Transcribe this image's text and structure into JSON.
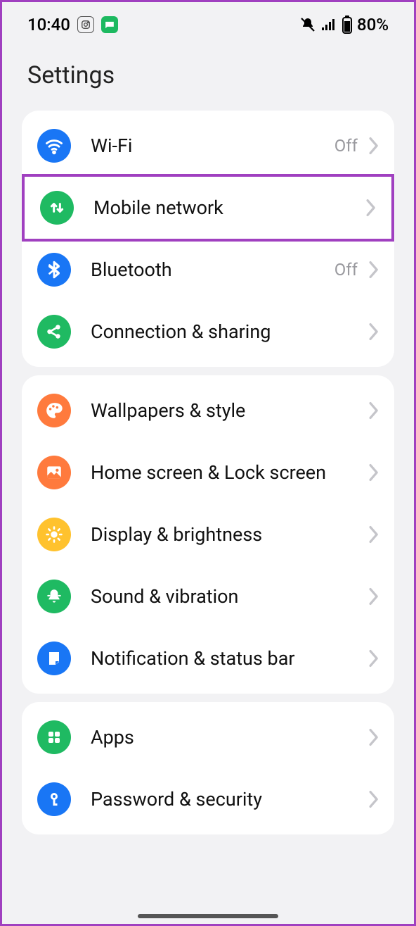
{
  "statusbar": {
    "time": "10:40",
    "battery": "80%"
  },
  "header": {
    "title": "Settings"
  },
  "groups": [
    {
      "rows": [
        {
          "id": "wifi",
          "label": "Wi-Fi",
          "status": "Off",
          "icon": "wifi-icon",
          "color": "c-blue",
          "highlight": false
        },
        {
          "id": "mobile-network",
          "label": "Mobile network",
          "status": "",
          "icon": "mobile-data-icon",
          "color": "c-green",
          "highlight": true
        },
        {
          "id": "bluetooth",
          "label": "Bluetooth",
          "status": "Off",
          "icon": "bluetooth-icon",
          "color": "c-blue",
          "highlight": false
        },
        {
          "id": "connection-sharing",
          "label": "Connection & sharing",
          "status": "",
          "icon": "share-icon",
          "color": "c-green",
          "highlight": false
        }
      ]
    },
    {
      "rows": [
        {
          "id": "wallpapers",
          "label": "Wallpapers & style",
          "status": "",
          "icon": "palette-icon",
          "color": "c-orange",
          "highlight": false
        },
        {
          "id": "home-lock",
          "label": "Home screen & Lock screen",
          "status": "",
          "icon": "picture-icon",
          "color": "c-orange",
          "highlight": false
        },
        {
          "id": "display",
          "label": "Display & brightness",
          "status": "",
          "icon": "brightness-icon",
          "color": "c-yellow",
          "highlight": false
        },
        {
          "id": "sound",
          "label": "Sound & vibration",
          "status": "",
          "icon": "bell-icon",
          "color": "c-green",
          "highlight": false
        },
        {
          "id": "notification",
          "label": "Notification & status bar",
          "status": "",
          "icon": "note-icon",
          "color": "c-dblue",
          "highlight": false
        }
      ]
    },
    {
      "rows": [
        {
          "id": "apps",
          "label": "Apps",
          "status": "",
          "icon": "apps-icon",
          "color": "c-green",
          "highlight": false
        },
        {
          "id": "password-security",
          "label": "Password & security",
          "status": "",
          "icon": "key-icon",
          "color": "c-blue",
          "highlight": false
        }
      ]
    }
  ]
}
